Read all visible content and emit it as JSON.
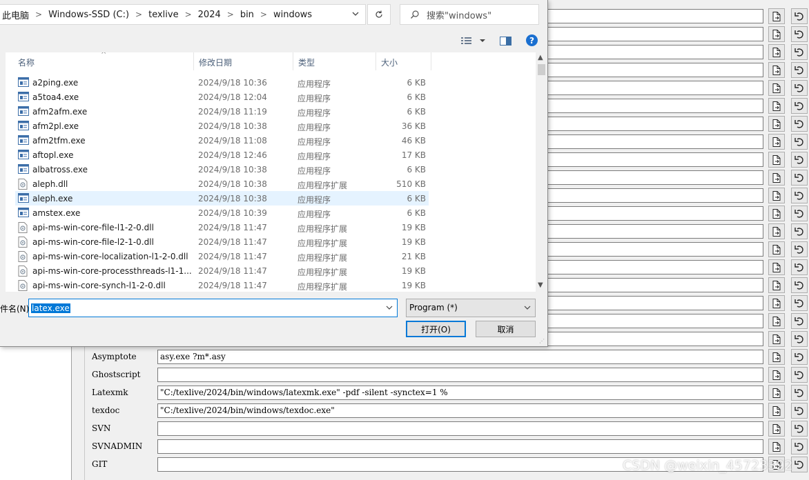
{
  "dialog": {
    "breadcrumbs": [
      "此电脑",
      "Windows-SSD (C:)",
      "texlive",
      "2024",
      "bin",
      "windows"
    ],
    "search_placeholder": "搜索\"windows\"",
    "columns": {
      "name": "名称",
      "date": "修改日期",
      "type": "类型",
      "size": "大小"
    },
    "files": [
      {
        "name": "a2ping.exe",
        "date": "2024/9/18 10:36",
        "type": "应用程序",
        "size": "6 KB",
        "kind": "exe"
      },
      {
        "name": "a5toa4.exe",
        "date": "2024/9/18 12:04",
        "type": "应用程序",
        "size": "6 KB",
        "kind": "exe"
      },
      {
        "name": "afm2afm.exe",
        "date": "2024/9/18 11:19",
        "type": "应用程序",
        "size": "6 KB",
        "kind": "exe"
      },
      {
        "name": "afm2pl.exe",
        "date": "2024/9/18 10:38",
        "type": "应用程序",
        "size": "36 KB",
        "kind": "exe"
      },
      {
        "name": "afm2tfm.exe",
        "date": "2024/9/18 11:08",
        "type": "应用程序",
        "size": "46 KB",
        "kind": "exe"
      },
      {
        "name": "aftopl.exe",
        "date": "2024/9/18 12:46",
        "type": "应用程序",
        "size": "17 KB",
        "kind": "exe"
      },
      {
        "name": "albatross.exe",
        "date": "2024/9/18 10:38",
        "type": "应用程序",
        "size": "6 KB",
        "kind": "exe"
      },
      {
        "name": "aleph.dll",
        "date": "2024/9/18 10:38",
        "type": "应用程序扩展",
        "size": "510 KB",
        "kind": "dll"
      },
      {
        "name": "aleph.exe",
        "date": "2024/9/18 10:38",
        "type": "应用程序",
        "size": "6 KB",
        "kind": "exe"
      },
      {
        "name": "amstex.exe",
        "date": "2024/9/18 10:39",
        "type": "应用程序",
        "size": "6 KB",
        "kind": "exe"
      },
      {
        "name": "api-ms-win-core-file-l1-2-0.dll",
        "date": "2024/9/18 11:47",
        "type": "应用程序扩展",
        "size": "19 KB",
        "kind": "dll"
      },
      {
        "name": "api-ms-win-core-file-l2-1-0.dll",
        "date": "2024/9/18 11:47",
        "type": "应用程序扩展",
        "size": "19 KB",
        "kind": "dll"
      },
      {
        "name": "api-ms-win-core-localization-l1-2-0.dll",
        "date": "2024/9/18 11:47",
        "type": "应用程序扩展",
        "size": "21 KB",
        "kind": "dll"
      },
      {
        "name": "api-ms-win-core-processthreads-l1-1...",
        "date": "2024/9/18 11:47",
        "type": "应用程序扩展",
        "size": "19 KB",
        "kind": "dll"
      },
      {
        "name": "api-ms-win-core-synch-l1-2-0.dll",
        "date": "2024/9/18 11:47",
        "type": "应用程序扩展",
        "size": "19 KB",
        "kind": "dll"
      }
    ],
    "selected_file": "aleph.exe",
    "filename_label": "件名(N):",
    "filename_value": "latex.exe",
    "filetype_value": "Program (*)",
    "open_label": "打开(O)",
    "cancel_label": "取消"
  },
  "config": {
    "rows": [
      {
        "label": "Asymptote",
        "value": "asy.exe ?m*.asy"
      },
      {
        "label": "Ghostscript",
        "value": ""
      },
      {
        "label": "Latexmk",
        "value": "\"C:/texlive/2024/bin/windows/latexmk.exe\" -pdf -silent -synctex=1 %"
      },
      {
        "label": "texdoc",
        "value": "\"C:/texlive/2024/bin/windows/texdoc.exe\""
      },
      {
        "label": "SVN",
        "value": ""
      },
      {
        "label": "SVNADMIN",
        "value": ""
      },
      {
        "label": "GIT",
        "value": ""
      }
    ]
  },
  "watermark": "CSDN @weixin_45723392"
}
